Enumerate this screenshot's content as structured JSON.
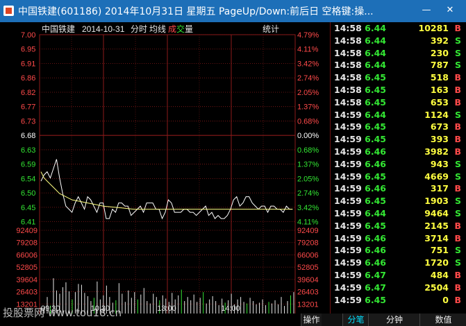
{
  "window": {
    "title": "中国铁建(601186) 2014年10月31日 星期五 PageUp/Down:前后日 空格键:操...",
    "minimize_glyph": "—",
    "close_glyph": "✕"
  },
  "chart_header": {
    "stock_name": "中国铁建",
    "date": "2014-10-31",
    "mode": "分时",
    "avg_line_label": "均线",
    "deal_label_a": "成",
    "deal_label_b": "交",
    "volume_label": "量",
    "stats_button": "统计"
  },
  "chart_data": {
    "type": "line",
    "price_axis": {
      "labels": [
        "7.00",
        "6.95",
        "6.91",
        "6.86",
        "6.82",
        "6.77",
        "6.73",
        "6.68",
        "6.63",
        "6.59",
        "6.54",
        "6.50",
        "6.45",
        "6.41"
      ],
      "percent_labels": [
        "4.79%",
        "4.11%",
        "3.42%",
        "2.74%",
        "2.05%",
        "1.37%",
        "0.68%",
        "0.00%",
        "0.68%",
        "1.37%",
        "2.05%",
        "2.74%",
        "3.42%",
        "4.11%"
      ],
      "reference": "6.68",
      "ylim": [
        6.41,
        7.0
      ]
    },
    "volume_axis": {
      "labels": [
        "92409",
        "79208",
        "66006",
        "52805",
        "39604",
        "26403",
        "13201"
      ]
    },
    "time_labels": [
      "09:30",
      "10:30",
      "13:00",
      "14:00"
    ],
    "series": [
      {
        "values": [
          6.54,
          6.56,
          6.57,
          6.55,
          6.58,
          6.61,
          6.55,
          6.5,
          6.46,
          6.45,
          6.44,
          6.47,
          6.49,
          6.47,
          6.45,
          6.49,
          6.48,
          6.46,
          6.44,
          6.47,
          6.47,
          6.42,
          6.42,
          6.45,
          6.44,
          6.47,
          6.47,
          6.46,
          6.46,
          6.43,
          6.44,
          6.45,
          6.46,
          6.44,
          6.47,
          6.47,
          6.47,
          6.45,
          6.45,
          6.42,
          6.44,
          6.48,
          6.47,
          6.44,
          6.44,
          6.44,
          6.45,
          6.45,
          6.44,
          6.44,
          6.43,
          6.44,
          6.45,
          6.46,
          6.43,
          6.44,
          6.42,
          6.43,
          6.42,
          6.42,
          6.43,
          6.45,
          6.48,
          6.49,
          6.46,
          6.47,
          6.49,
          6.49,
          6.47,
          6.46,
          6.45,
          6.46,
          6.46,
          6.44,
          6.46,
          6.46,
          6.45,
          6.45,
          6.44,
          6.46,
          6.45,
          6.45
        ]
      },
      {
        "values": [
          6.57,
          6.55,
          6.54,
          6.53,
          6.52,
          6.51,
          6.5,
          6.495,
          6.49,
          6.485,
          6.48,
          6.478,
          6.476,
          6.474,
          6.472,
          6.47,
          6.468,
          6.466,
          6.464,
          6.462,
          6.46,
          6.459,
          6.458,
          6.457,
          6.456,
          6.455,
          6.454,
          6.453,
          6.452,
          6.451,
          6.45,
          6.45,
          6.45,
          6.45,
          6.45,
          6.45,
          6.45,
          6.45,
          6.45,
          6.45,
          6.45,
          6.45,
          6.45,
          6.45,
          6.45,
          6.45,
          6.45,
          6.45,
          6.45,
          6.45,
          6.45,
          6.45,
          6.45,
          6.45,
          6.45,
          6.45,
          6.45,
          6.45,
          6.45,
          6.45,
          6.45,
          6.45,
          6.45,
          6.45,
          6.45,
          6.45,
          6.45,
          6.45,
          6.45,
          6.45,
          6.45,
          6.45,
          6.45,
          6.45,
          6.45,
          6.45,
          6.45,
          6.45,
          6.45,
          6.45,
          6.45,
          6.45
        ]
      }
    ],
    "volumes": [
      9000,
      10500,
      22000,
      11500,
      45000,
      30000,
      26000,
      34000,
      40000,
      29000,
      19000,
      28000,
      38000,
      37000,
      27000,
      23000,
      17000,
      21000,
      41000,
      19000,
      24000,
      36000,
      22000,
      15000,
      18000,
      39000,
      26000,
      16000,
      30000,
      21000,
      28000,
      19000,
      25000,
      33000,
      17000,
      14000,
      26000,
      22000,
      18000,
      24000,
      20000,
      16000,
      27000,
      19000,
      24000,
      31000,
      17000,
      22000,
      18000,
      25000,
      16000,
      21000,
      28000,
      14000,
      19000,
      23000,
      17000,
      12000,
      20000,
      15000,
      18000,
      26000,
      13000,
      19000,
      22000,
      16000,
      14000,
      21000,
      17000,
      13000,
      15000,
      19000,
      12000,
      16000,
      14000,
      18000,
      13000,
      22000,
      11000,
      17000,
      24000,
      28000
    ],
    "volume_ylim": [
      0,
      105610
    ]
  },
  "trades": [
    {
      "time": "14:58",
      "price": "6.44",
      "volume": "10281",
      "dir": "B"
    },
    {
      "time": "14:58",
      "price": "6.44",
      "volume": "392",
      "dir": "S"
    },
    {
      "time": "14:58",
      "price": "6.44",
      "volume": "230",
      "dir": "S"
    },
    {
      "time": "14:58",
      "price": "6.44",
      "volume": "787",
      "dir": "S"
    },
    {
      "time": "14:58",
      "price": "6.45",
      "volume": "518",
      "dir": "B"
    },
    {
      "time": "14:58",
      "price": "6.45",
      "volume": "163",
      "dir": "B"
    },
    {
      "time": "14:58",
      "price": "6.45",
      "volume": "653",
      "dir": "B"
    },
    {
      "time": "14:59",
      "price": "6.44",
      "volume": "1124",
      "dir": "S"
    },
    {
      "time": "14:59",
      "price": "6.45",
      "volume": "673",
      "dir": "B"
    },
    {
      "time": "14:59",
      "price": "6.45",
      "volume": "393",
      "dir": "B"
    },
    {
      "time": "14:59",
      "price": "6.46",
      "volume": "3982",
      "dir": "B"
    },
    {
      "time": "14:59",
      "price": "6.46",
      "volume": "943",
      "dir": "S"
    },
    {
      "time": "14:59",
      "price": "6.45",
      "volume": "4669",
      "dir": "S"
    },
    {
      "time": "14:59",
      "price": "6.46",
      "volume": "317",
      "dir": "B"
    },
    {
      "time": "14:59",
      "price": "6.45",
      "volume": "1903",
      "dir": "S"
    },
    {
      "time": "14:59",
      "price": "6.44",
      "volume": "9464",
      "dir": "S"
    },
    {
      "time": "14:59",
      "price": "6.45",
      "volume": "2145",
      "dir": "B"
    },
    {
      "time": "14:59",
      "price": "6.46",
      "volume": "3714",
      "dir": "B"
    },
    {
      "time": "14:59",
      "price": "6.46",
      "volume": "751",
      "dir": "S"
    },
    {
      "time": "14:59",
      "price": "6.46",
      "volume": "1720",
      "dir": "S"
    },
    {
      "time": "14:59",
      "price": "6.47",
      "volume": "484",
      "dir": "B"
    },
    {
      "time": "14:59",
      "price": "6.47",
      "volume": "2504",
      "dir": "B"
    },
    {
      "time": "14:59",
      "price": "6.45",
      "volume": "0",
      "dir": "B"
    }
  ],
  "tabs": [
    {
      "label": "操作"
    },
    {
      "label": "分笔"
    },
    {
      "label": "分钟"
    },
    {
      "label": "数值"
    }
  ],
  "watermark": "投股票网 www.tou18.cn",
  "colors": {
    "up": "#ff4a4a",
    "down": "#33e633",
    "neutral": "#ffffff",
    "grid": "#8b1a1a",
    "price_line": "#ffffff",
    "avg_line": "#ffff80",
    "volume_bar": "#e8e8e8",
    "volume_bar_up": "#33e633",
    "accent_tab": "#00e0ff"
  }
}
